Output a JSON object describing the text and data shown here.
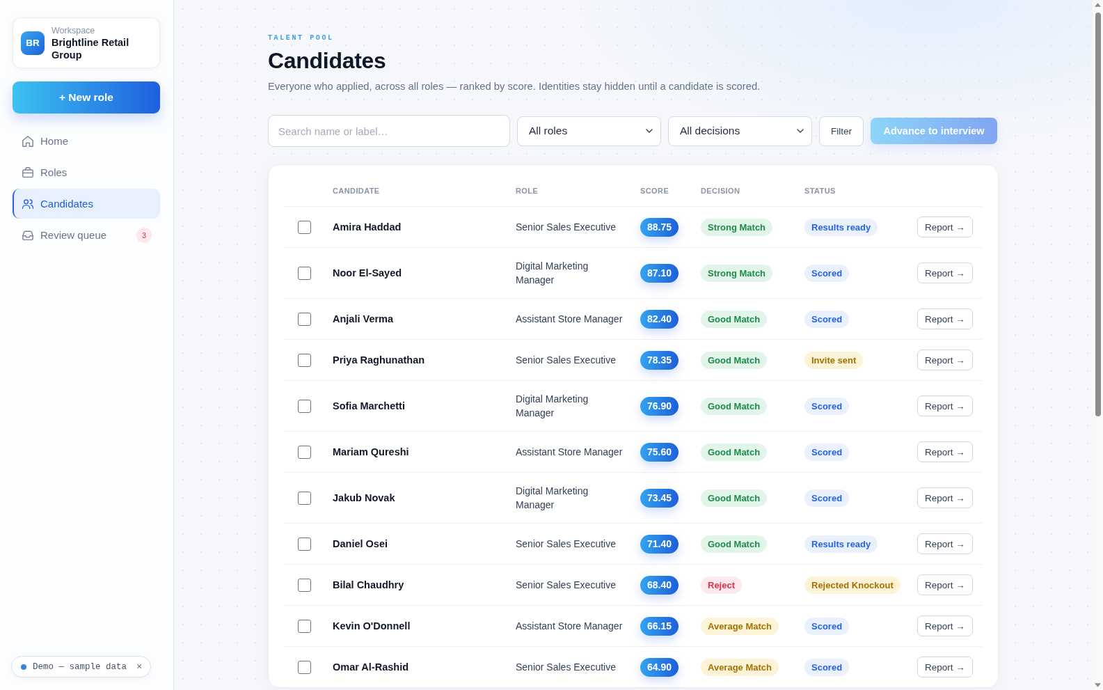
{
  "sidebar": {
    "workspace": {
      "initials": "BR",
      "label": "Workspace",
      "name": "Brightline Retail Group"
    },
    "new_role_button": "+ New role",
    "nav": [
      {
        "label": "Home",
        "selected": false
      },
      {
        "label": "Roles",
        "selected": false
      },
      {
        "label": "Candidates",
        "selected": true
      },
      {
        "label": "Review queue",
        "selected": false,
        "badge": "3"
      }
    ],
    "demo_banner": {
      "text": "Demo — sample data",
      "close": "×"
    }
  },
  "header": {
    "eyebrow": "TALENT POOL",
    "title": "Candidates",
    "subtitle": "Everyone who applied, across all roles — ranked by score. Identities stay hidden until a candidate is scored."
  },
  "toolbar": {
    "search": {
      "placeholder": "Search name or label…"
    },
    "role_filter": "All roles",
    "decision_filter": "All decisions",
    "filter_button": "Filter",
    "advance_button": {
      "label": "Advance to interview",
      "disabled": true
    }
  },
  "table": {
    "columns": [
      "CANDIDATE",
      "ROLE",
      "SCORE",
      "DECISION",
      "STATUS"
    ],
    "rows": [
      {
        "checked": false,
        "name": "Amira Haddad",
        "role": "Senior Sales Executive",
        "score": "88.75",
        "decision": {
          "label": "Strong Match",
          "kind": "success"
        },
        "status": {
          "label": "Results ready",
          "kind": "info"
        },
        "action": "Report →"
      },
      {
        "checked": false,
        "name": "Noor El-Sayed",
        "role": "Digital Marketing Manager",
        "score": "87.10",
        "decision": {
          "label": "Strong Match",
          "kind": "success"
        },
        "status": {
          "label": "Scored",
          "kind": "info"
        },
        "action": "Report →"
      },
      {
        "checked": false,
        "name": "Anjali Verma",
        "role": "Assistant Store Manager",
        "score": "82.40",
        "decision": {
          "label": "Good Match",
          "kind": "success"
        },
        "status": {
          "label": "Scored",
          "kind": "info"
        },
        "action": "Report →"
      },
      {
        "checked": false,
        "name": "Priya Raghunathan",
        "role": "Senior Sales Executive",
        "score": "78.35",
        "decision": {
          "label": "Good Match",
          "kind": "success"
        },
        "status": {
          "label": "Invite sent",
          "kind": "warning"
        },
        "action": "Report →"
      },
      {
        "checked": false,
        "name": "Sofia Marchetti",
        "role": "Digital Marketing Manager",
        "score": "76.90",
        "decision": {
          "label": "Good Match",
          "kind": "success"
        },
        "status": {
          "label": "Scored",
          "kind": "info"
        },
        "action": "Report →"
      },
      {
        "checked": false,
        "name": "Mariam Qureshi",
        "role": "Assistant Store Manager",
        "score": "75.60",
        "decision": {
          "label": "Good Match",
          "kind": "success"
        },
        "status": {
          "label": "Scored",
          "kind": "info"
        },
        "action": "Report →"
      },
      {
        "checked": false,
        "name": "Jakub Novak",
        "role": "Digital Marketing Manager",
        "score": "73.45",
        "decision": {
          "label": "Good Match",
          "kind": "success"
        },
        "status": {
          "label": "Scored",
          "kind": "info"
        },
        "action": "Report →"
      },
      {
        "checked": false,
        "name": "Daniel Osei",
        "role": "Senior Sales Executive",
        "score": "71.40",
        "decision": {
          "label": "Good Match",
          "kind": "success"
        },
        "status": {
          "label": "Results ready",
          "kind": "info"
        },
        "action": "Report →"
      },
      {
        "checked": false,
        "name": "Bilal Chaudhry",
        "role": "Senior Sales Executive",
        "score": "68.40",
        "decision": {
          "label": "Reject",
          "kind": "danger"
        },
        "status": {
          "label": "Rejected Knockout",
          "kind": "warning"
        },
        "action": "Report →"
      },
      {
        "checked": false,
        "name": "Kevin O'Donnell",
        "role": "Assistant Store Manager",
        "score": "66.15",
        "decision": {
          "label": "Average Match",
          "kind": "warning"
        },
        "status": {
          "label": "Scored",
          "kind": "info"
        },
        "action": "Report →"
      },
      {
        "checked": false,
        "name": "Omar Al-Rashid",
        "role": "Senior Sales Executive",
        "score": "64.90",
        "decision": {
          "label": "Average Match",
          "kind": "warning"
        },
        "status": {
          "label": "Scored",
          "kind": "info"
        },
        "action": "Report →"
      }
    ]
  }
}
